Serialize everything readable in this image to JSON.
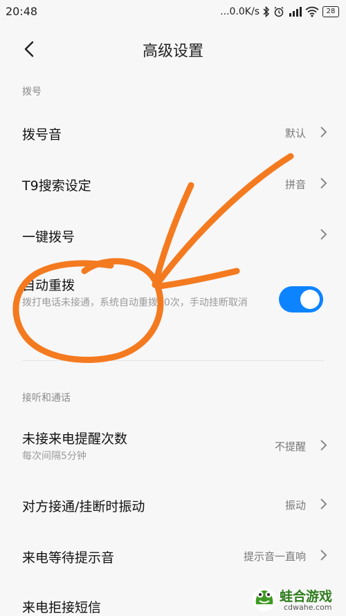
{
  "status_bar": {
    "time": "20:48",
    "net_speed": "...0.0K/s",
    "battery": "28",
    "icons": [
      "bluetooth-icon",
      "alarm-icon",
      "signal-icon",
      "wifi-icon",
      "battery-icon"
    ]
  },
  "header": {
    "title": "高级设置",
    "back_icon": "back-arrow-icon"
  },
  "sections": {
    "dial": {
      "label": "拨号"
    },
    "call": {
      "label": "接听和通话"
    }
  },
  "rows": {
    "dial_tone": {
      "title": "拨号音",
      "value": "默认"
    },
    "t9": {
      "title": "T9搜索设定",
      "value": "拼音"
    },
    "speed_dial": {
      "title": "一键拨号"
    },
    "redial": {
      "title": "自动重拨",
      "subtitle": "拨打电话未接通，系统自动重拨10次，手动挂断取消",
      "enabled": true
    },
    "missed_reminder": {
      "title": "未接来电提醒次数",
      "subtitle": "每次间隔5分钟",
      "value": "不提醒"
    },
    "connect_vibrate": {
      "title": "对方接通/挂断时振动",
      "value": "振动"
    },
    "waiting_tone": {
      "title": "来电等待提示音",
      "value": "提示音一直响"
    },
    "reject_sms": {
      "title": "来电拒接短信"
    }
  },
  "colors": {
    "accent": "#0d84ff",
    "annotation": "#f47a20",
    "background": "#f7f7f7"
  },
  "watermark": {
    "brand": "蛙合游戏",
    "url": "cdwahe.com"
  }
}
